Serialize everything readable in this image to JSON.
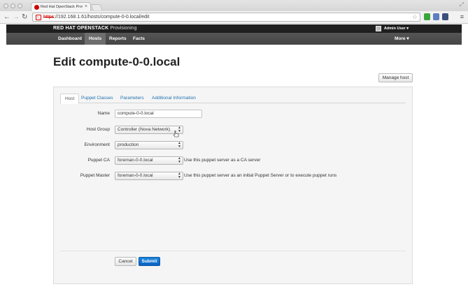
{
  "browser": {
    "tab_title": "Red Hat OpenStack Provisio",
    "tab_close": "×",
    "url_scheme": "https",
    "url_rest": "://192.168.1.61/hosts/compute-0-0.local/edit",
    "icons": [
      "back-icon",
      "forward-icon",
      "reload-icon",
      "star-icon",
      "menu-icon"
    ],
    "colors": {
      "insecure": "#cc0000"
    }
  },
  "app": {
    "brand_bold": "RED HAT OPENSTACK",
    "brand_light": "Provisioning",
    "user": "Admin User ▾",
    "nav": [
      {
        "label": "Dashboard"
      },
      {
        "label": "Hosts",
        "active": true
      },
      {
        "label": "Reports"
      },
      {
        "label": "Facts"
      }
    ],
    "more": "More ▾"
  },
  "page": {
    "title": "Edit compute-0-0.local",
    "manage_host": "Manage host"
  },
  "tabs": [
    "Host",
    "Puppet Classes",
    "Parameters",
    "Additional Information"
  ],
  "form": {
    "name": {
      "label": "Name",
      "value": "compute-0-0.local"
    },
    "host_group": {
      "label": "Host Group",
      "value": "Controller (Nova Network)"
    },
    "environment": {
      "label": "Environment",
      "value": "production"
    },
    "puppet_ca": {
      "label": "Puppet CA",
      "value": "foreman-0-0.local",
      "help": "Use this puppet server as a CA server"
    },
    "puppet_master": {
      "label": "Puppet Master",
      "value": "foreman-0-0.local",
      "help": "Use this puppet server as an initial Puppet Server or to execute puppet runs"
    },
    "cancel": "Cancel",
    "submit": "Submit"
  },
  "colors": {
    "primary": "#0b62c0",
    "link": "#1f6fae",
    "navbar": "#4a4a4a"
  }
}
